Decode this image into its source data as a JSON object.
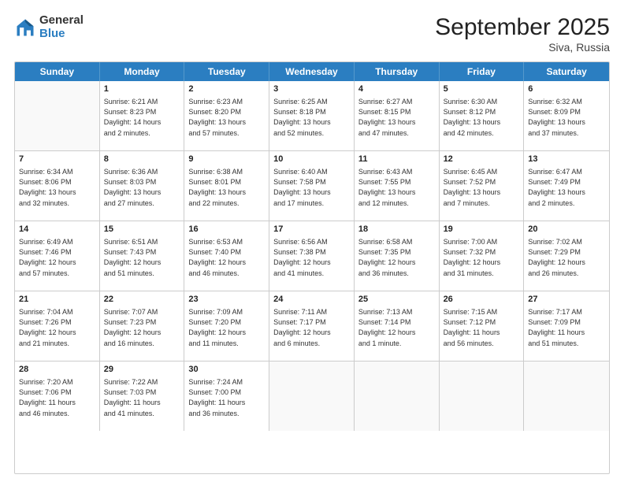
{
  "logo": {
    "general": "General",
    "blue": "Blue"
  },
  "title": "September 2025",
  "location": "Siva, Russia",
  "days": [
    "Sunday",
    "Monday",
    "Tuesday",
    "Wednesday",
    "Thursday",
    "Friday",
    "Saturday"
  ],
  "weeks": [
    [
      {
        "day": "",
        "content": ""
      },
      {
        "day": "1",
        "content": "Sunrise: 6:21 AM\nSunset: 8:23 PM\nDaylight: 14 hours\nand 2 minutes."
      },
      {
        "day": "2",
        "content": "Sunrise: 6:23 AM\nSunset: 8:20 PM\nDaylight: 13 hours\nand 57 minutes."
      },
      {
        "day": "3",
        "content": "Sunrise: 6:25 AM\nSunset: 8:18 PM\nDaylight: 13 hours\nand 52 minutes."
      },
      {
        "day": "4",
        "content": "Sunrise: 6:27 AM\nSunset: 8:15 PM\nDaylight: 13 hours\nand 47 minutes."
      },
      {
        "day": "5",
        "content": "Sunrise: 6:30 AM\nSunset: 8:12 PM\nDaylight: 13 hours\nand 42 minutes."
      },
      {
        "day": "6",
        "content": "Sunrise: 6:32 AM\nSunset: 8:09 PM\nDaylight: 13 hours\nand 37 minutes."
      }
    ],
    [
      {
        "day": "7",
        "content": "Sunrise: 6:34 AM\nSunset: 8:06 PM\nDaylight: 13 hours\nand 32 minutes."
      },
      {
        "day": "8",
        "content": "Sunrise: 6:36 AM\nSunset: 8:03 PM\nDaylight: 13 hours\nand 27 minutes."
      },
      {
        "day": "9",
        "content": "Sunrise: 6:38 AM\nSunset: 8:01 PM\nDaylight: 13 hours\nand 22 minutes."
      },
      {
        "day": "10",
        "content": "Sunrise: 6:40 AM\nSunset: 7:58 PM\nDaylight: 13 hours\nand 17 minutes."
      },
      {
        "day": "11",
        "content": "Sunrise: 6:43 AM\nSunset: 7:55 PM\nDaylight: 13 hours\nand 12 minutes."
      },
      {
        "day": "12",
        "content": "Sunrise: 6:45 AM\nSunset: 7:52 PM\nDaylight: 13 hours\nand 7 minutes."
      },
      {
        "day": "13",
        "content": "Sunrise: 6:47 AM\nSunset: 7:49 PM\nDaylight: 13 hours\nand 2 minutes."
      }
    ],
    [
      {
        "day": "14",
        "content": "Sunrise: 6:49 AM\nSunset: 7:46 PM\nDaylight: 12 hours\nand 57 minutes."
      },
      {
        "day": "15",
        "content": "Sunrise: 6:51 AM\nSunset: 7:43 PM\nDaylight: 12 hours\nand 51 minutes."
      },
      {
        "day": "16",
        "content": "Sunrise: 6:53 AM\nSunset: 7:40 PM\nDaylight: 12 hours\nand 46 minutes."
      },
      {
        "day": "17",
        "content": "Sunrise: 6:56 AM\nSunset: 7:38 PM\nDaylight: 12 hours\nand 41 minutes."
      },
      {
        "day": "18",
        "content": "Sunrise: 6:58 AM\nSunset: 7:35 PM\nDaylight: 12 hours\nand 36 minutes."
      },
      {
        "day": "19",
        "content": "Sunrise: 7:00 AM\nSunset: 7:32 PM\nDaylight: 12 hours\nand 31 minutes."
      },
      {
        "day": "20",
        "content": "Sunrise: 7:02 AM\nSunset: 7:29 PM\nDaylight: 12 hours\nand 26 minutes."
      }
    ],
    [
      {
        "day": "21",
        "content": "Sunrise: 7:04 AM\nSunset: 7:26 PM\nDaylight: 12 hours\nand 21 minutes."
      },
      {
        "day": "22",
        "content": "Sunrise: 7:07 AM\nSunset: 7:23 PM\nDaylight: 12 hours\nand 16 minutes."
      },
      {
        "day": "23",
        "content": "Sunrise: 7:09 AM\nSunset: 7:20 PM\nDaylight: 12 hours\nand 11 minutes."
      },
      {
        "day": "24",
        "content": "Sunrise: 7:11 AM\nSunset: 7:17 PM\nDaylight: 12 hours\nand 6 minutes."
      },
      {
        "day": "25",
        "content": "Sunrise: 7:13 AM\nSunset: 7:14 PM\nDaylight: 12 hours\nand 1 minute."
      },
      {
        "day": "26",
        "content": "Sunrise: 7:15 AM\nSunset: 7:12 PM\nDaylight: 11 hours\nand 56 minutes."
      },
      {
        "day": "27",
        "content": "Sunrise: 7:17 AM\nSunset: 7:09 PM\nDaylight: 11 hours\nand 51 minutes."
      }
    ],
    [
      {
        "day": "28",
        "content": "Sunrise: 7:20 AM\nSunset: 7:06 PM\nDaylight: 11 hours\nand 46 minutes."
      },
      {
        "day": "29",
        "content": "Sunrise: 7:22 AM\nSunset: 7:03 PM\nDaylight: 11 hours\nand 41 minutes."
      },
      {
        "day": "30",
        "content": "Sunrise: 7:24 AM\nSunset: 7:00 PM\nDaylight: 11 hours\nand 36 minutes."
      },
      {
        "day": "",
        "content": ""
      },
      {
        "day": "",
        "content": ""
      },
      {
        "day": "",
        "content": ""
      },
      {
        "day": "",
        "content": ""
      }
    ]
  ]
}
